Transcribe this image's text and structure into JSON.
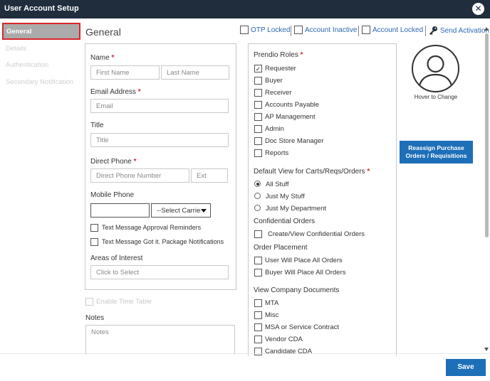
{
  "window": {
    "title": "User Account Setup",
    "close_icon": "close-icon"
  },
  "sidebar": {
    "items": [
      {
        "label": "General",
        "active": true
      },
      {
        "label": "Details"
      },
      {
        "label": "Authentication"
      },
      {
        "label": "Secondary Notification"
      }
    ]
  },
  "page": {
    "heading": "General"
  },
  "flags": {
    "otp_locked": "OTP Locked",
    "account_inactive": "Account Inactive",
    "account_locked": "Account Locked",
    "send_activation": "Send Activation",
    "send_activation_icon": "key-icon"
  },
  "form": {
    "name_label": "Name",
    "required_mark": "*",
    "first_name_placeholder": "First Name",
    "last_name_placeholder": "Last Name",
    "email_label": "Email Address",
    "email_placeholder": "Email",
    "title_label": "Title",
    "title_placeholder": "Title",
    "direct_phone_label": "Direct Phone",
    "direct_phone_placeholder": "Direct Phone Number",
    "ext_placeholder": "Ext",
    "mobile_phone_label": "Mobile Phone",
    "carrier_select": "--Select Carrier",
    "sms_approval": "Text Message Approval Reminders",
    "sms_package": "Text Message Got it. Package Notifications",
    "areas_label": "Areas of Interest",
    "areas_placeholder": "Click to Select",
    "enable_time_table": "Enable Time Table",
    "notes_label": "Notes",
    "notes_placeholder": "Notes"
  },
  "roles": {
    "label": "Prendio Roles",
    "items": [
      {
        "label": "Requester",
        "checked": true
      },
      {
        "label": "Buyer",
        "checked": false
      },
      {
        "label": "Receiver",
        "checked": false
      },
      {
        "label": "Accounts Payable",
        "checked": false
      },
      {
        "label": "AP Management",
        "checked": false
      },
      {
        "label": "Admin",
        "checked": false
      },
      {
        "label": "Doc Store Manager",
        "checked": false
      },
      {
        "label": "Reports",
        "checked": false
      }
    ],
    "default_view_label": "Default View for Carts/Reqs/Orders",
    "default_view_options": [
      {
        "label": "All Stuff",
        "selected": true
      },
      {
        "label": "Just My Stuff",
        "selected": false
      },
      {
        "label": "Just My Department",
        "selected": false
      }
    ],
    "confidential_label": "Confidential Orders",
    "confidential_option": "Create/View Confidential Orders",
    "order_placement_label": "Order Placement",
    "order_placement_options": [
      "User Will Place All Orders",
      "Buyer Will Place All Orders"
    ],
    "company_docs_label": "View Company Documents",
    "company_docs": [
      "MTA",
      "Misc",
      "MSA or Service Contract",
      "Vendor CDA",
      "Candidate CDA"
    ]
  },
  "profile": {
    "avatar_icon": "user-silhouette-icon",
    "hover_text": "Hover to Change",
    "reassign_button_line1": "Reassign Purchase",
    "reassign_button_line2": "Orders / Requisitions"
  },
  "footer": {
    "save_label": "Save"
  }
}
